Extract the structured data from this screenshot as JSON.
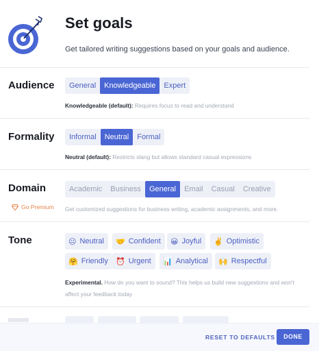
{
  "header": {
    "title": "Set goals",
    "subtitle": "Get tailored writing suggestions based on your goals and audience."
  },
  "audience": {
    "label": "Audience",
    "options": [
      "General",
      "Knowledgeable",
      "Expert"
    ],
    "selected": "Knowledgeable",
    "desc_strong": "Knowledgeable (default):",
    "desc": " Requires focus to read and understand"
  },
  "formality": {
    "label": "Formality",
    "options": [
      "Informal",
      "Neutral",
      "Formal"
    ],
    "selected": "Neutral",
    "desc_strong": "Neutral (default):",
    "desc": " Restricts slang but allows standard casual expressions"
  },
  "domain": {
    "label": "Domain",
    "options": [
      "Academic",
      "Business",
      "General",
      "Email",
      "Casual",
      "Creative"
    ],
    "selected": "General",
    "premium_label": "Go Premium",
    "desc": "Get customized suggestions for business writing, academic assignments, and more."
  },
  "tone": {
    "label": "Tone",
    "items": [
      {
        "emoji": "😐",
        "label": "Neutral"
      },
      {
        "emoji": "🤝",
        "label": "Confident"
      },
      {
        "emoji": "😀",
        "label": "Joyful"
      },
      {
        "emoji": "✌️",
        "label": "Optimistic"
      },
      {
        "emoji": "🤗",
        "label": "Friendly"
      },
      {
        "emoji": "⏰",
        "label": "Urgent"
      },
      {
        "emoji": "📊",
        "label": "Analytical"
      },
      {
        "emoji": "🙌",
        "label": "Respectful"
      }
    ],
    "exp_strong": "Experimental.",
    "exp_text": " How do you want to sound? This helps us build new suggestions and won't affect your feedback today"
  },
  "footer": {
    "reset_label": "RESET TO DEFAULTS",
    "done_label": "DONE"
  },
  "colors": {
    "accent": "#4a66d4",
    "accent_text": "#4a5fc1",
    "chip_bg": "#eef0f8",
    "premium": "#e5834a"
  }
}
